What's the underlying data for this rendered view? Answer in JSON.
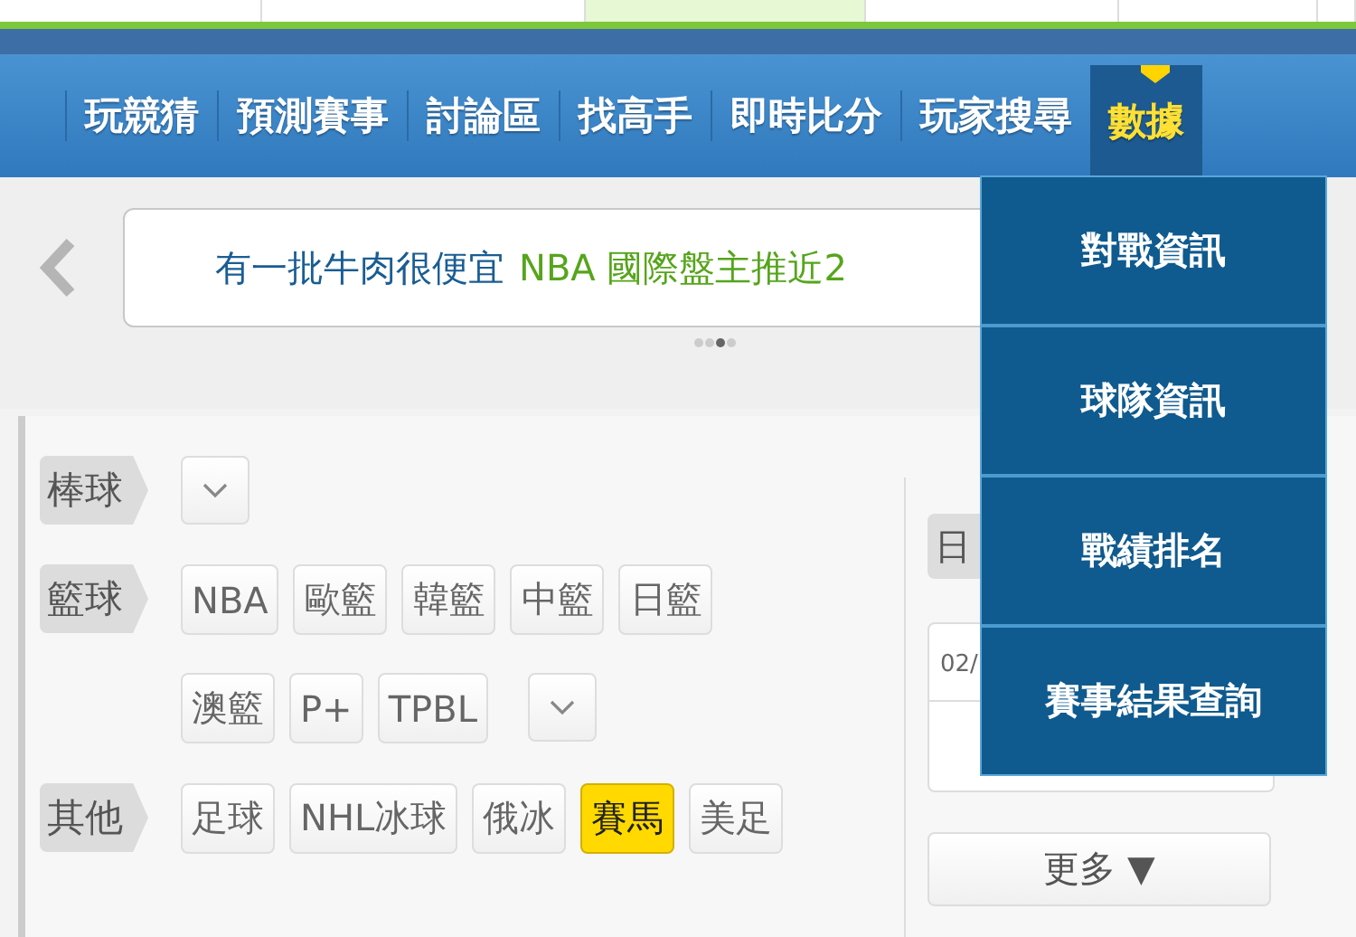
{
  "browser_tabs": [
    {
      "selected": false
    },
    {
      "selected": false
    },
    {
      "selected": true
    },
    {
      "selected": false
    },
    {
      "selected": false
    },
    {
      "selected": false
    }
  ],
  "nav": {
    "items": [
      {
        "label": "玩競猜",
        "selected": false
      },
      {
        "label": "預測賽事",
        "selected": false
      },
      {
        "label": "討論區",
        "selected": false
      },
      {
        "label": "找高手",
        "selected": false
      },
      {
        "label": "即時比分",
        "selected": false
      },
      {
        "label": "玩家搜尋",
        "selected": false
      },
      {
        "label": "數據",
        "selected": true
      }
    ]
  },
  "dropdown": {
    "items": [
      "對戰資訊",
      "球隊資訊",
      "戰績排名",
      "賽事結果查詢"
    ]
  },
  "banner": {
    "text_blue": "有一批牛肉很便宜",
    "text_green": "NBA 國際盤主推近2",
    "dots": [
      {
        "selected": false
      },
      {
        "selected": false
      },
      {
        "selected": true
      },
      {
        "selected": false
      }
    ]
  },
  "filters": [
    {
      "category": "棒球",
      "lines": [
        [
          {
            "kind": "more"
          }
        ]
      ]
    },
    {
      "category": "籃球",
      "lines": [
        [
          {
            "kind": "chip",
            "label": "NBA",
            "selected": false
          },
          {
            "kind": "chip",
            "label": "歐籃",
            "selected": false
          },
          {
            "kind": "chip",
            "label": "韓籃",
            "selected": false
          },
          {
            "kind": "chip",
            "label": "中籃",
            "selected": false
          },
          {
            "kind": "chip",
            "label": "日籃",
            "selected": false
          }
        ],
        [
          {
            "kind": "chip",
            "label": "澳籃",
            "selected": false
          },
          {
            "kind": "chip",
            "label": "P+",
            "selected": false
          },
          {
            "kind": "chip",
            "label": "TPBL",
            "selected": false
          },
          {
            "kind": "more"
          }
        ]
      ]
    },
    {
      "category": "其他",
      "lines": [
        [
          {
            "kind": "chip",
            "label": "足球",
            "selected": false
          },
          {
            "kind": "chip",
            "label": "NHL冰球",
            "selected": false
          },
          {
            "kind": "chip",
            "label": "俄冰",
            "selected": false
          },
          {
            "kind": "chip",
            "label": "賽馬",
            "selected": true
          },
          {
            "kind": "chip",
            "label": "美足",
            "selected": false
          }
        ]
      ]
    }
  ],
  "side": {
    "tab": "日",
    "date": "02/",
    "more_button": "更多 ▼"
  }
}
